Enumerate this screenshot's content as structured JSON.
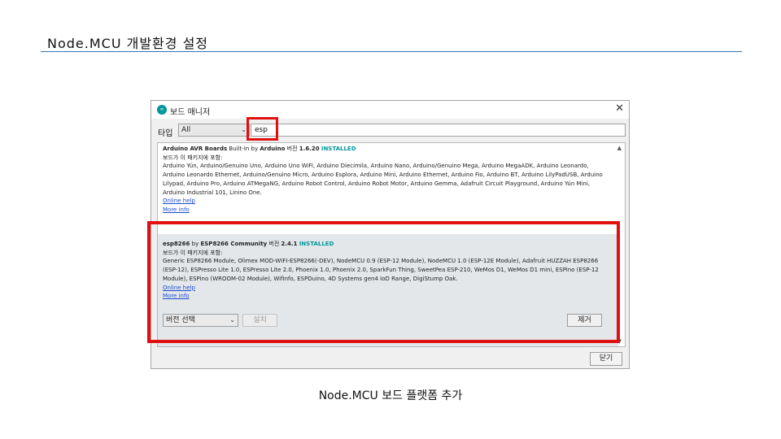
{
  "slide": {
    "title": "Node.MCU 개발환경 설정",
    "caption": "Node.MCU 보드 플랫폼 추가",
    "accent_color": "#2e75b6",
    "highlight_color": "#e01010"
  },
  "window": {
    "icon": "arduino-icon",
    "icon_text": "∞",
    "title": "보드 매니저",
    "close_glyph": "✕"
  },
  "filter": {
    "type_label": "타입",
    "type_value": "All",
    "search_value": "esp"
  },
  "boards": [
    {
      "name": "Arduino AVR Boards",
      "by_text": "Built-In by",
      "author": "Arduino",
      "version_label": "버전",
      "version": "1.6.20",
      "status": "INSTALLED",
      "included_label": "보드가 이 패키지에 포함:",
      "boards_list": "Arduino Yún, Arduino/Genuino Uno, Arduino Uno WiFi, Arduino Diecimila, Arduino Nano, Arduino/Genuino Mega, Arduino MegaADK, Arduino Leonardo, Arduino Leonardo Ethernet, Arduino/Genuino Micro, Arduino Esplora, Arduino Mini, Arduino Ethernet, Arduino Fio, Arduino BT, Arduino LilyPadUSB, Arduino Lilypad, Arduino Pro, Arduino ATMegaNG, Arduino Robot Control, Arduino Robot Motor, Arduino Gemma, Adafruit Circuit Playground, Arduino Yún Mini, Arduino Industrial 101, Linino One.",
      "online_help": "Online help",
      "more_info": "More info"
    },
    {
      "name": "esp8266",
      "by_text": "by",
      "author": "ESP8266 Community",
      "version_label": "버전",
      "version": "2.4.1",
      "status": "INSTALLED",
      "included_label": "보드가 이 패키지에 포함:",
      "boards_list": "Generic ESP8266 Module, Olimex MOD-WIFI-ESP8266(-DEV), NodeMCU 0.9 (ESP-12 Module), NodeMCU 1.0 (ESP-12E Module), Adafruit HUZZAH ESP8266 (ESP-12), ESPresso Lite 1.0, ESPresso Lite 2.0, Phoenix 1.0, Phoenix 2.0, SparkFun Thing, SweetPea ESP-210, WeMos D1, WeMos D1 mini, ESPino (ESP-12 Module), ESPino (WROOM-02 Module), WifInfo, ESPDuino, 4D Systems gen4 IoD Range, DigiStump Oak.",
      "online_help": "Online help",
      "more_info": "More info",
      "version_select": "버전 선택",
      "install_label": "설치",
      "remove_label": "제거"
    }
  ],
  "footer": {
    "close_label": "닫기"
  }
}
